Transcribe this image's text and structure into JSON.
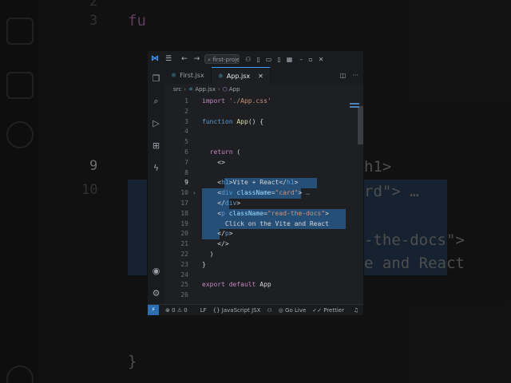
{
  "background": {
    "line_numbers": [
      {
        "n": "2"
      },
      {
        "n": "3"
      },
      {
        "n": "9",
        "current": true
      },
      {
        "n": "10"
      }
    ],
    "code_fragments": [
      {
        "text": "fu",
        "color": "#c586c0"
      },
      {
        "text": "h1>",
        "color": "#8d8d8d"
      },
      {
        "text": "rd\"> …",
        "color": "#8d8d8d"
      },
      {
        "text": "-the-docs\">",
        "color": "#8d8d8d"
      },
      {
        "text": "e and React",
        "color": "#8d8d8d"
      },
      {
        "text": "}",
        "color": "#8d8d8d"
      }
    ]
  },
  "titlebar": {
    "menu_icon": "hamburger-icon",
    "back_icon": "arrow-left-icon",
    "forward_icon": "arrow-right-icon",
    "search_text": "first-project",
    "layout_icons": [
      "copilot-icon",
      "layout-sidebar-icon",
      "layout-panel-icon",
      "layout-sidebar-right-icon",
      "layout-grid-icon"
    ],
    "window_controls": [
      "minimize-icon",
      "maximize-icon",
      "close-icon"
    ]
  },
  "activity_bar": {
    "top": [
      "explorer-icon",
      "search-icon",
      "run-debug-icon",
      "extensions-icon",
      "lightning-icon"
    ],
    "bottom": [
      "account-icon",
      "settings-gear-icon"
    ]
  },
  "tabs": [
    {
      "label": "First.jsx",
      "active": false
    },
    {
      "label": "App.jsx",
      "active": true
    }
  ],
  "breadcrumb": {
    "items": [
      "src",
      "App.jsx",
      "App"
    ]
  },
  "editor": {
    "lines": [
      {
        "n": "1",
        "tokens": [
          {
            "t": "import ",
            "c": "kw"
          },
          {
            "t": "'./App.css'",
            "c": "str"
          }
        ]
      },
      {
        "n": "2",
        "tokens": []
      },
      {
        "n": "3",
        "tokens": [
          {
            "t": "function ",
            "c": "kb"
          },
          {
            "t": "App",
            "c": "fn"
          },
          {
            "t": "() {",
            "c": "br"
          }
        ]
      },
      {
        "n": "4",
        "tokens": []
      },
      {
        "n": "5",
        "tokens": []
      },
      {
        "n": "6",
        "tokens": [
          {
            "t": "  return ",
            "c": "kw"
          },
          {
            "t": "(",
            "c": "br"
          }
        ]
      },
      {
        "n": "7",
        "tokens": [
          {
            "t": "    <>",
            "c": "br"
          }
        ]
      },
      {
        "n": "8",
        "tokens": []
      },
      {
        "n": "9",
        "current": true,
        "tokens": [
          {
            "t": "    <",
            "c": "br"
          },
          {
            "t": "h1",
            "c": "tag"
          },
          {
            "t": ">Vite + React</",
            "c": "br"
          },
          {
            "t": "h1",
            "c": "tag"
          },
          {
            "t": ">",
            "c": "br"
          }
        ]
      },
      {
        "n": "10",
        "fold": true,
        "tokens": [
          {
            "t": "    <",
            "c": "br"
          },
          {
            "t": "div ",
            "c": "tag"
          },
          {
            "t": "className",
            "c": "attr"
          },
          {
            "t": "=",
            "c": "br"
          },
          {
            "t": "\"card\"",
            "c": "str"
          },
          {
            "t": ">",
            "c": "br"
          },
          {
            "t": " …",
            "c": "ghost"
          }
        ]
      },
      {
        "n": "17",
        "tokens": [
          {
            "t": "    </",
            "c": "br"
          },
          {
            "t": "div",
            "c": "tag"
          },
          {
            "t": ">",
            "c": "br"
          }
        ]
      },
      {
        "n": "18",
        "tokens": [
          {
            "t": "    <",
            "c": "br"
          },
          {
            "t": "p ",
            "c": "tag"
          },
          {
            "t": "className",
            "c": "attr"
          },
          {
            "t": "=",
            "c": "br"
          },
          {
            "t": "\"read-the-docs\"",
            "c": "str"
          },
          {
            "t": ">",
            "c": "br"
          }
        ]
      },
      {
        "n": "19",
        "tokens": [
          {
            "t": "      Click on the Vite and React",
            "c": "br"
          }
        ]
      },
      {
        "n": "20",
        "tokens": [
          {
            "t": "    </",
            "c": "br"
          },
          {
            "t": "p",
            "c": "tag"
          },
          {
            "t": ">",
            "c": "br"
          }
        ]
      },
      {
        "n": "21",
        "tokens": [
          {
            "t": "    </>",
            "c": "br"
          }
        ]
      },
      {
        "n": "22",
        "tokens": [
          {
            "t": "  )",
            "c": "br"
          }
        ]
      },
      {
        "n": "23",
        "tokens": [
          {
            "t": "}",
            "c": "br"
          }
        ]
      },
      {
        "n": "24",
        "tokens": []
      },
      {
        "n": "25",
        "tokens": [
          {
            "t": "export default ",
            "c": "kw"
          },
          {
            "t": "App",
            "c": "br"
          }
        ]
      },
      {
        "n": "26",
        "tokens": []
      }
    ]
  },
  "statusbar": {
    "remote_icon": "remote-icon",
    "problems": "⊗ 0 ⚠ 0",
    "eol": "LF",
    "language": "{} JavaScript JSX",
    "go_live": "Go Live",
    "prettier": "✓✓ Prettier",
    "bell_icon": "bell-icon"
  },
  "colors": {
    "accent": "#3aa0ff",
    "selection": "#264f78",
    "editor_bg": "#1e1f22"
  }
}
